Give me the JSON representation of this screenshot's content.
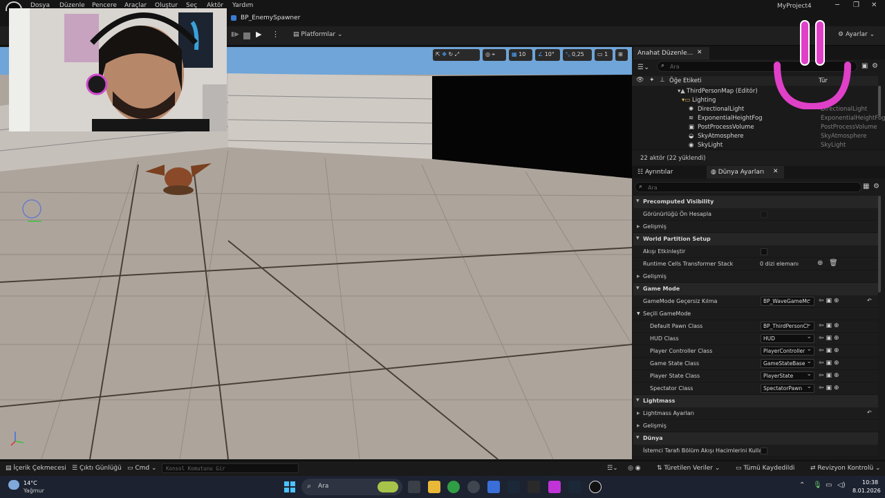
{
  "menu": [
    "Dosya",
    "Düzenle",
    "Pencere",
    "Araçlar",
    "Oluştur",
    "Seç",
    "Aktör",
    "Yardım"
  ],
  "project_title": "MyProject4",
  "tab": {
    "label": "BP_EnemySpawner"
  },
  "toolbar": {
    "platforms_label": "Platformlar",
    "settings_label": "Ayarlar"
  },
  "viewport": {
    "grid_value": "10",
    "rot_value": "10°",
    "scale_value": "0,25",
    "camera_value": "1"
  },
  "outliner": {
    "tab_label": "Anahat Düzenle...",
    "search_placeholder": "Ara",
    "col_label": "Öğe Etiketi",
    "col_type": "Tür",
    "rows": [
      {
        "name": "ThirdPersonMap (Editör)",
        "type": ""
      },
      {
        "name": "Lighting",
        "type": ""
      },
      {
        "name": "DirectionalLight",
        "type": "DirectionalLight"
      },
      {
        "name": "ExponentialHeightFog",
        "type": "ExponentialHeightFog"
      },
      {
        "name": "PostProcessVolume",
        "type": "PostProcessVolume"
      },
      {
        "name": "SkyAtmosphere",
        "type": "SkyAtmosphere"
      },
      {
        "name": "SkyLight",
        "type": "SkyLight"
      }
    ],
    "count": "22 aktör (22 yüklendi)"
  },
  "details": {
    "tab1": "Ayrıntılar",
    "tab2": "Dünya Ayarları",
    "search_placeholder": "Ara",
    "precomputed": "Precomputed Visibility",
    "visibility_calc": "Görünürlüğü Ön Hesapla",
    "advanced": "Gelişmiş",
    "world_partition": "World Partition Setup",
    "enable_streaming": "Akışı Etkinleştir",
    "runtime_cells": "Runtime Cells Transformer Stack",
    "runtime_cells_value": "0 dizi elemanı",
    "game_mode": "Game Mode",
    "gm_override": "GameMode Geçersiz Kılma",
    "gm_override_value": "BP_WaveGameMc",
    "selected_gm": "Seçili GameMode",
    "classes": [
      {
        "label": "Default Pawn Class",
        "value": "BP_ThirdPersonCl"
      },
      {
        "label": "HUD Class",
        "value": "HUD"
      },
      {
        "label": "Player Controller Class",
        "value": "PlayerController"
      },
      {
        "label": "Game State Class",
        "value": "GameStateBase"
      },
      {
        "label": "Player State Class",
        "value": "PlayerState"
      },
      {
        "label": "Spectator Class",
        "value": "SpectatorPawn"
      }
    ],
    "lightmass": "Lightmass",
    "lightmass_settings": "Lightmass Ayarları",
    "world": "Dünya",
    "client_streaming": "İstemci Tarafı Bölüm Akışı Hacimlerini Kullan"
  },
  "statusbar": {
    "content_drawer": "İçerik Çekmecesi",
    "output_log": "Çıktı Günlüğü",
    "cmd": "Cmd",
    "console_placeholder": "Konsol Komutunu Gir",
    "derived": "Türetilen Veriler",
    "saved": "Tümü Kaydedildi",
    "revision": "Revizyon Kontrolü"
  },
  "taskbar": {
    "temp": "14°C",
    "weather": "Yağmur",
    "search": "Ara",
    "time": "10:38",
    "date": "8.01.2026"
  }
}
